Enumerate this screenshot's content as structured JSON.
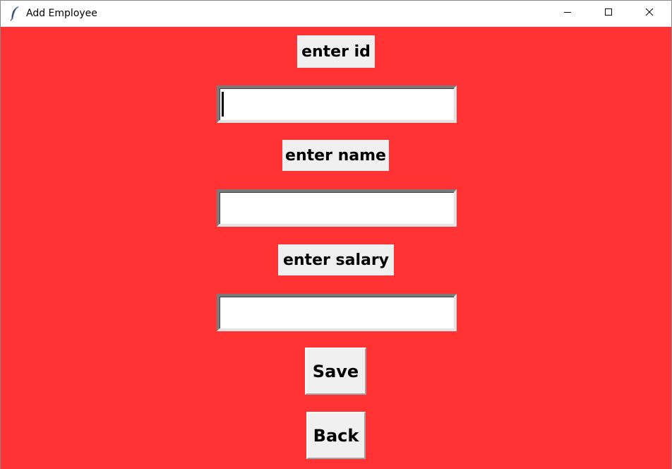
{
  "window": {
    "title": "Add Employee",
    "icon": "feather-icon",
    "controls": [
      "minimize-icon",
      "maximize-icon",
      "close-icon"
    ]
  },
  "colors": {
    "background": "#ff3333",
    "widget": "#f0f0f0",
    "entry": "#ffffff"
  },
  "form": {
    "id_label": "enter id",
    "id_value": "",
    "name_label": "enter name",
    "name_value": "",
    "salary_label": "enter salary",
    "salary_value": ""
  },
  "buttons": {
    "save_label": "Save",
    "back_label": "Back"
  }
}
